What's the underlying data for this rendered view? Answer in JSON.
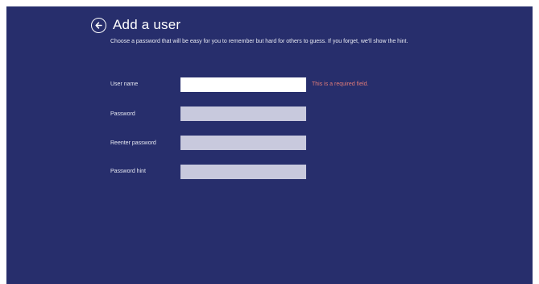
{
  "page": {
    "title": "Add a user",
    "description": "Choose a password that will be easy for you to remember but hard for others to guess. If you forget, we'll show the hint."
  },
  "form": {
    "username": {
      "label": "User name",
      "value": "",
      "error": "This is a required field."
    },
    "password": {
      "label": "Password",
      "value": ""
    },
    "reenter_password": {
      "label": "Reenter password",
      "value": ""
    },
    "password_hint": {
      "label": "Password hint",
      "value": ""
    }
  },
  "icons": {
    "back": "back-arrow-circle-icon"
  },
  "colors": {
    "background": "#272e6c",
    "input_active": "#ffffff",
    "input_inactive": "#c8c9dd",
    "error": "#e07b78"
  }
}
